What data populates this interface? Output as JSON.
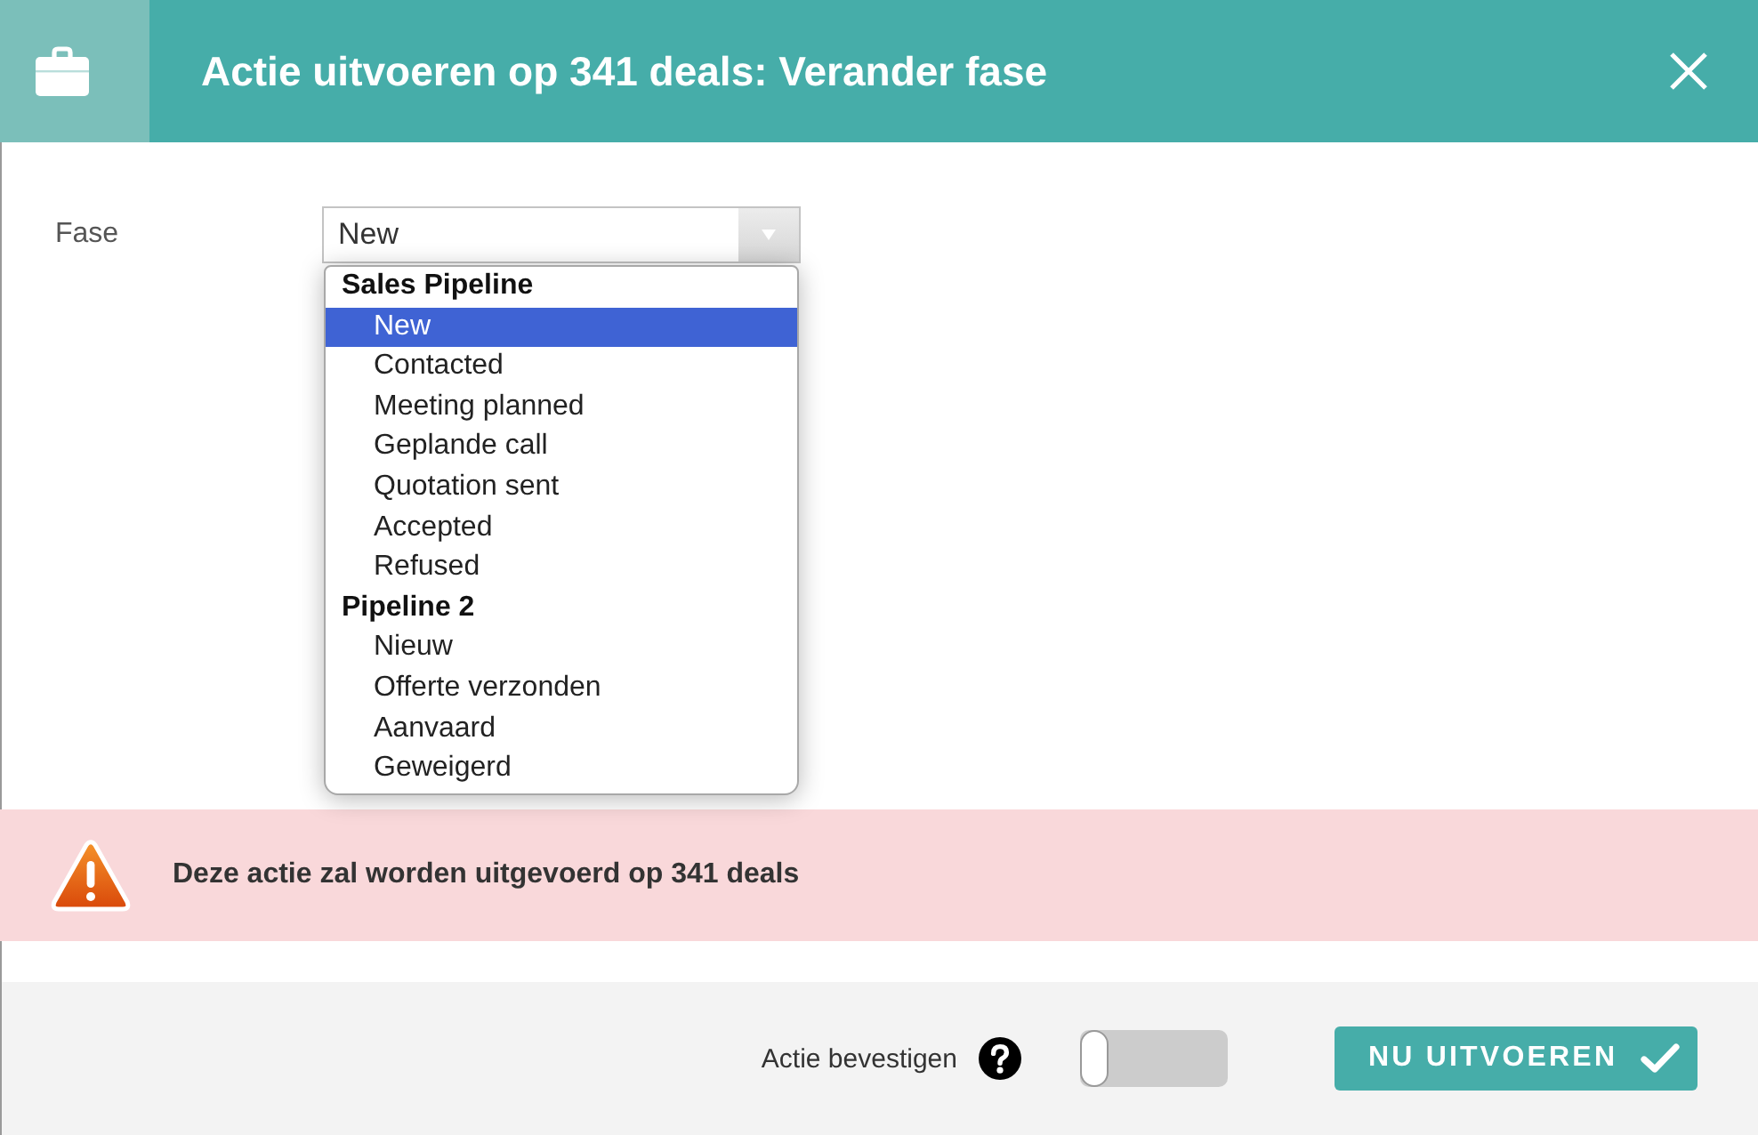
{
  "window": {
    "title": "Actie uitvoeren op 341 deals: Verander fase"
  },
  "form": {
    "field_label": "Fase",
    "select": {
      "value": "New",
      "expanded": true
    }
  },
  "dropdown": {
    "groups": [
      {
        "label": "Sales Pipeline",
        "options": [
          {
            "label": "New",
            "selected": true
          },
          {
            "label": "Contacted",
            "selected": false
          },
          {
            "label": "Meeting planned",
            "selected": false
          },
          {
            "label": "Geplande call",
            "selected": false
          },
          {
            "label": "Quotation sent",
            "selected": false
          },
          {
            "label": "Accepted",
            "selected": false
          },
          {
            "label": "Refused",
            "selected": false
          }
        ]
      },
      {
        "label": "Pipeline 2",
        "options": [
          {
            "label": "Nieuw",
            "selected": false
          },
          {
            "label": "Offerte verzonden",
            "selected": false
          },
          {
            "label": "Aanvaard",
            "selected": false
          },
          {
            "label": "Geweigerd",
            "selected": false
          }
        ]
      }
    ]
  },
  "alert": {
    "text": "Deze actie zal worden uitgevoerd op 341 deals"
  },
  "footer": {
    "confirm_label": "Actie bevestigen",
    "confirm_toggle": {
      "on": false
    },
    "button": "NU UITVOEREN"
  }
}
